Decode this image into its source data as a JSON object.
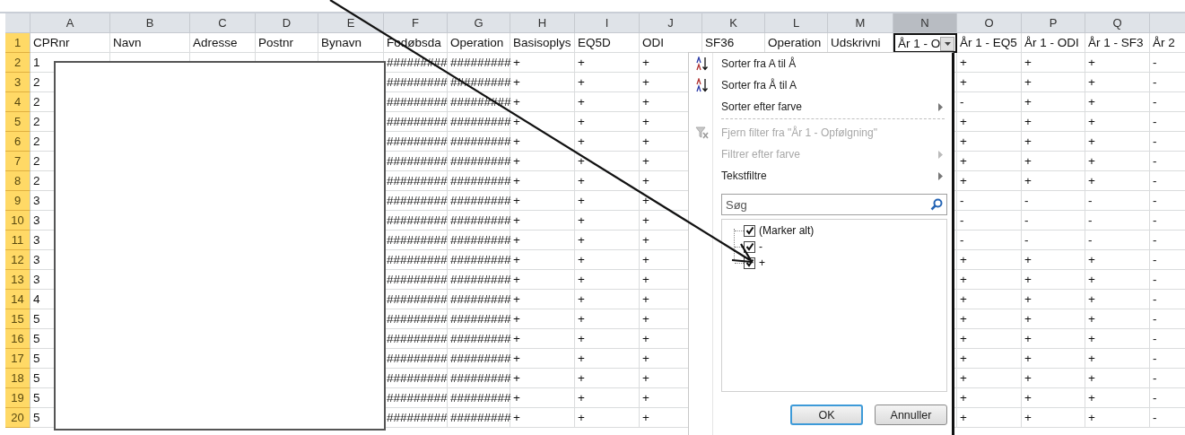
{
  "columns": [
    {
      "label": "A",
      "selected": false
    },
    {
      "label": "B",
      "selected": false
    },
    {
      "label": "C",
      "selected": false
    },
    {
      "label": "D",
      "selected": false
    },
    {
      "label": "E",
      "selected": false
    },
    {
      "label": "F",
      "selected": false
    },
    {
      "label": "G",
      "selected": false
    },
    {
      "label": "H",
      "selected": false
    },
    {
      "label": "I",
      "selected": false
    },
    {
      "label": "J",
      "selected": false
    },
    {
      "label": "K",
      "selected": false
    },
    {
      "label": "L",
      "selected": false
    },
    {
      "label": "M",
      "selected": false
    },
    {
      "label": "N",
      "selected": true
    },
    {
      "label": "O",
      "selected": false
    },
    {
      "label": "P",
      "selected": false
    },
    {
      "label": "Q",
      "selected": false
    }
  ],
  "header_row": {
    "number": "1",
    "selected": true,
    "cells": [
      "CPRnr",
      "Navn",
      "Adresse",
      "Postnr",
      "Bynavn",
      "Fodøbsda",
      "Operation",
      "Basisoplys",
      "EQ5D",
      "ODI",
      "SF36",
      "Operation",
      "Udskrivni",
      "År 1 - O",
      "År 1 - EQ5",
      "År 1 - ODI",
      "År 1 - SF3",
      "År 2"
    ]
  },
  "rows": [
    {
      "number": "2",
      "selected": true,
      "cells": [
        "1",
        null,
        null,
        null,
        null,
        "#########",
        "#########",
        "+",
        "+",
        "+",
        null,
        null,
        null,
        null,
        "+",
        "+",
        "+",
        "-"
      ]
    },
    {
      "number": "3",
      "selected": true,
      "cells": [
        "2",
        null,
        null,
        null,
        null,
        "#########",
        "#########",
        "+",
        "+",
        "+",
        null,
        null,
        null,
        null,
        "+",
        "+",
        "+",
        "-"
      ]
    },
    {
      "number": "4",
      "selected": true,
      "cells": [
        "2",
        null,
        null,
        null,
        null,
        "#########",
        "#########",
        "+",
        "+",
        "+",
        null,
        null,
        null,
        null,
        "-",
        "+",
        "+",
        "-"
      ]
    },
    {
      "number": "5",
      "selected": true,
      "cells": [
        "2",
        null,
        null,
        null,
        null,
        "#########",
        "#########",
        "+",
        "+",
        "+",
        null,
        null,
        null,
        null,
        "+",
        "+",
        "+",
        "-"
      ]
    },
    {
      "number": "6",
      "selected": true,
      "cells": [
        "2",
        null,
        null,
        null,
        null,
        "#########",
        "#########",
        "+",
        "+",
        "+",
        null,
        null,
        null,
        null,
        "+",
        "+",
        "+",
        "-"
      ]
    },
    {
      "number": "7",
      "selected": true,
      "cells": [
        "2",
        null,
        null,
        null,
        null,
        "#########",
        "#########",
        "+",
        "+",
        "+",
        null,
        null,
        null,
        null,
        "+",
        "+",
        "+",
        "-"
      ]
    },
    {
      "number": "8",
      "selected": true,
      "cells": [
        "2",
        null,
        null,
        null,
        null,
        "#########",
        "#########",
        "+",
        "+",
        "+",
        null,
        null,
        null,
        null,
        "+",
        "+",
        "+",
        "-"
      ]
    },
    {
      "number": "9",
      "selected": true,
      "cells": [
        "3",
        null,
        null,
        null,
        null,
        "#########",
        "#########",
        "+",
        "+",
        "+",
        null,
        null,
        null,
        null,
        "-",
        "-",
        "-",
        "-"
      ]
    },
    {
      "number": "10",
      "selected": true,
      "cells": [
        "3",
        null,
        null,
        null,
        null,
        "#########",
        "#########",
        "+",
        "+",
        "+",
        null,
        null,
        null,
        null,
        "-",
        "-",
        "-",
        "-"
      ]
    },
    {
      "number": "11",
      "selected": true,
      "cells": [
        "3",
        null,
        null,
        null,
        null,
        "#########",
        "#########",
        "+",
        "+",
        "+",
        null,
        null,
        null,
        null,
        "-",
        "-",
        "-",
        "-"
      ]
    },
    {
      "number": "12",
      "selected": true,
      "cells": [
        "3",
        null,
        null,
        null,
        null,
        "#########",
        "#########",
        "+",
        "+",
        "+",
        null,
        null,
        null,
        null,
        "+",
        "+",
        "+",
        "-"
      ]
    },
    {
      "number": "13",
      "selected": true,
      "cells": [
        "3",
        null,
        null,
        null,
        null,
        "#########",
        "#########",
        "+",
        "+",
        "+",
        null,
        null,
        null,
        null,
        "+",
        "+",
        "+",
        "-"
      ]
    },
    {
      "number": "14",
      "selected": true,
      "cells": [
        "4",
        null,
        null,
        null,
        null,
        "#########",
        "#########",
        "+",
        "+",
        "+",
        null,
        null,
        null,
        null,
        "+",
        "+",
        "+",
        "-"
      ]
    },
    {
      "number": "15",
      "selected": true,
      "cells": [
        "5",
        null,
        null,
        null,
        null,
        "#########",
        "#########",
        "+",
        "+",
        "+",
        null,
        null,
        null,
        null,
        "+",
        "+",
        "+",
        "-"
      ]
    },
    {
      "number": "16",
      "selected": true,
      "cells": [
        "5",
        null,
        null,
        null,
        null,
        "#########",
        "#########",
        "+",
        "+",
        "+",
        null,
        null,
        null,
        null,
        "+",
        "+",
        "+",
        "-"
      ]
    },
    {
      "number": "17",
      "selected": true,
      "cells": [
        "5",
        null,
        null,
        null,
        null,
        "#########",
        "#########",
        "+",
        "+",
        "+",
        null,
        null,
        null,
        null,
        "+",
        "+",
        "+",
        "-"
      ]
    },
    {
      "number": "18",
      "selected": true,
      "cells": [
        "5",
        null,
        null,
        null,
        null,
        "#########",
        "#########",
        "+",
        "+",
        "+",
        null,
        null,
        null,
        null,
        "+",
        "+",
        "+",
        "-"
      ]
    },
    {
      "number": "19",
      "selected": true,
      "cells": [
        "5",
        null,
        null,
        null,
        null,
        "#########",
        "#########",
        "+",
        "+",
        "+",
        null,
        null,
        null,
        null,
        "+",
        "+",
        "+",
        "-"
      ]
    },
    {
      "number": "20",
      "selected": true,
      "cells": [
        "5",
        null,
        null,
        null,
        null,
        "#########",
        "#########",
        "+",
        "+",
        "+",
        null,
        null,
        null,
        null,
        "+",
        "+",
        "+",
        "-"
      ]
    }
  ],
  "filter_menu": {
    "items": [
      {
        "kind": "item",
        "label": "Sorter fra A til Å",
        "disabled": false,
        "submenu": false
      },
      {
        "kind": "item",
        "label": "Sorter fra Å til A",
        "disabled": false,
        "submenu": false
      },
      {
        "kind": "item",
        "label": "Sorter efter farve",
        "disabled": false,
        "submenu": true
      },
      {
        "kind": "separator"
      },
      {
        "kind": "item",
        "label": "Fjern filter fra \"År 1 - Opfølgning\"",
        "disabled": true,
        "submenu": false
      },
      {
        "kind": "item",
        "label": "Filtrer efter farve",
        "disabled": true,
        "submenu": true
      },
      {
        "kind": "item",
        "label": "Tekstfiltre",
        "disabled": false,
        "submenu": true
      }
    ],
    "search": {
      "placeholder": "Søg"
    },
    "values": [
      {
        "label": "(Marker alt)",
        "checked": true
      },
      {
        "label": "-",
        "checked": true
      },
      {
        "label": "+",
        "checked": true
      }
    ],
    "buttons": [
      {
        "label": "OK",
        "focused": true
      },
      {
        "label": "Annuller",
        "focused": false
      }
    ]
  }
}
